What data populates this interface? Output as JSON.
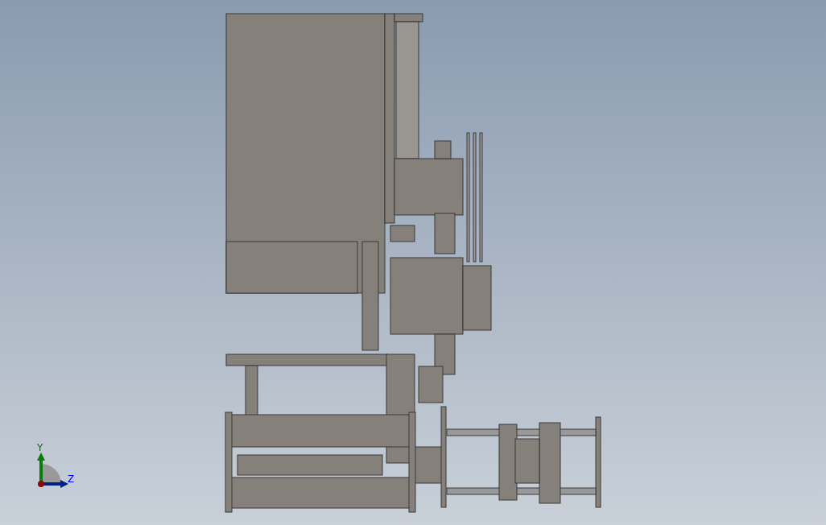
{
  "viewport": {
    "triad": {
      "y_label": "Y",
      "z_label": "Z"
    }
  }
}
